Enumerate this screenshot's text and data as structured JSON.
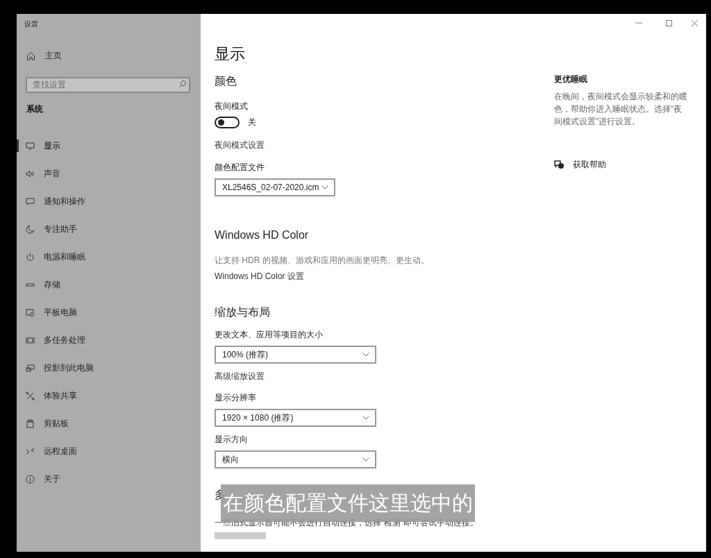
{
  "window": {
    "title": "设置"
  },
  "sidebar": {
    "home": "主页",
    "search": {
      "placeholder": "查找设置"
    },
    "section": "系统",
    "items": [
      {
        "label": "显示",
        "selected": true
      },
      {
        "label": "声音",
        "selected": false
      },
      {
        "label": "通知和操作",
        "selected": false
      },
      {
        "label": "专注助手",
        "selected": false
      },
      {
        "label": "电源和睡眠",
        "selected": false
      },
      {
        "label": "存储",
        "selected": false
      },
      {
        "label": "平板电脑",
        "selected": false
      },
      {
        "label": "多任务处理",
        "selected": false
      },
      {
        "label": "投影到此电脑",
        "selected": false
      },
      {
        "label": "体验共享",
        "selected": false
      },
      {
        "label": "剪贴板",
        "selected": false
      },
      {
        "label": "远程桌面",
        "selected": false
      },
      {
        "label": "关于",
        "selected": false
      }
    ]
  },
  "page": {
    "title": "显示",
    "color": {
      "heading": "颜色",
      "night_label": "夜间模式",
      "night_toggle": {
        "on": false,
        "text": "关"
      },
      "night_link": "夜间模式设置",
      "profile_label": "颜色配置文件",
      "profile_value": "XL2546S_02-07-2020.icm"
    },
    "hd": {
      "heading": "Windows HD Color",
      "description": "让支持 HDR 的视频、游戏和应用的画面更明亮、更生动。",
      "link": "Windows HD Color 设置"
    },
    "scale": {
      "heading": "缩放与布局",
      "size_label": "更改文本、应用等项目的大小",
      "size_value": "100% (推荐)",
      "advanced_link": "高级缩放设置",
      "resolution_label": "显示分辨率",
      "resolution_value": "1920 × 1080 (推荐)",
      "orientation_label": "显示方向",
      "orientation_value": "横向"
    },
    "multi": {
      "heading": "多",
      "description": "一些旧式显示器可能不会进行自动连接，选择“检测”即可尝试手动连接。"
    }
  },
  "aside": {
    "heading": "更优睡眠",
    "text": "在晚间，夜间模式会显示较柔和的暖色，帮助你进入睡眠状态。选择“夜间模式设置”进行设置。",
    "help": "获取帮助"
  },
  "caption": "在颜色配置文件这里选中的"
}
